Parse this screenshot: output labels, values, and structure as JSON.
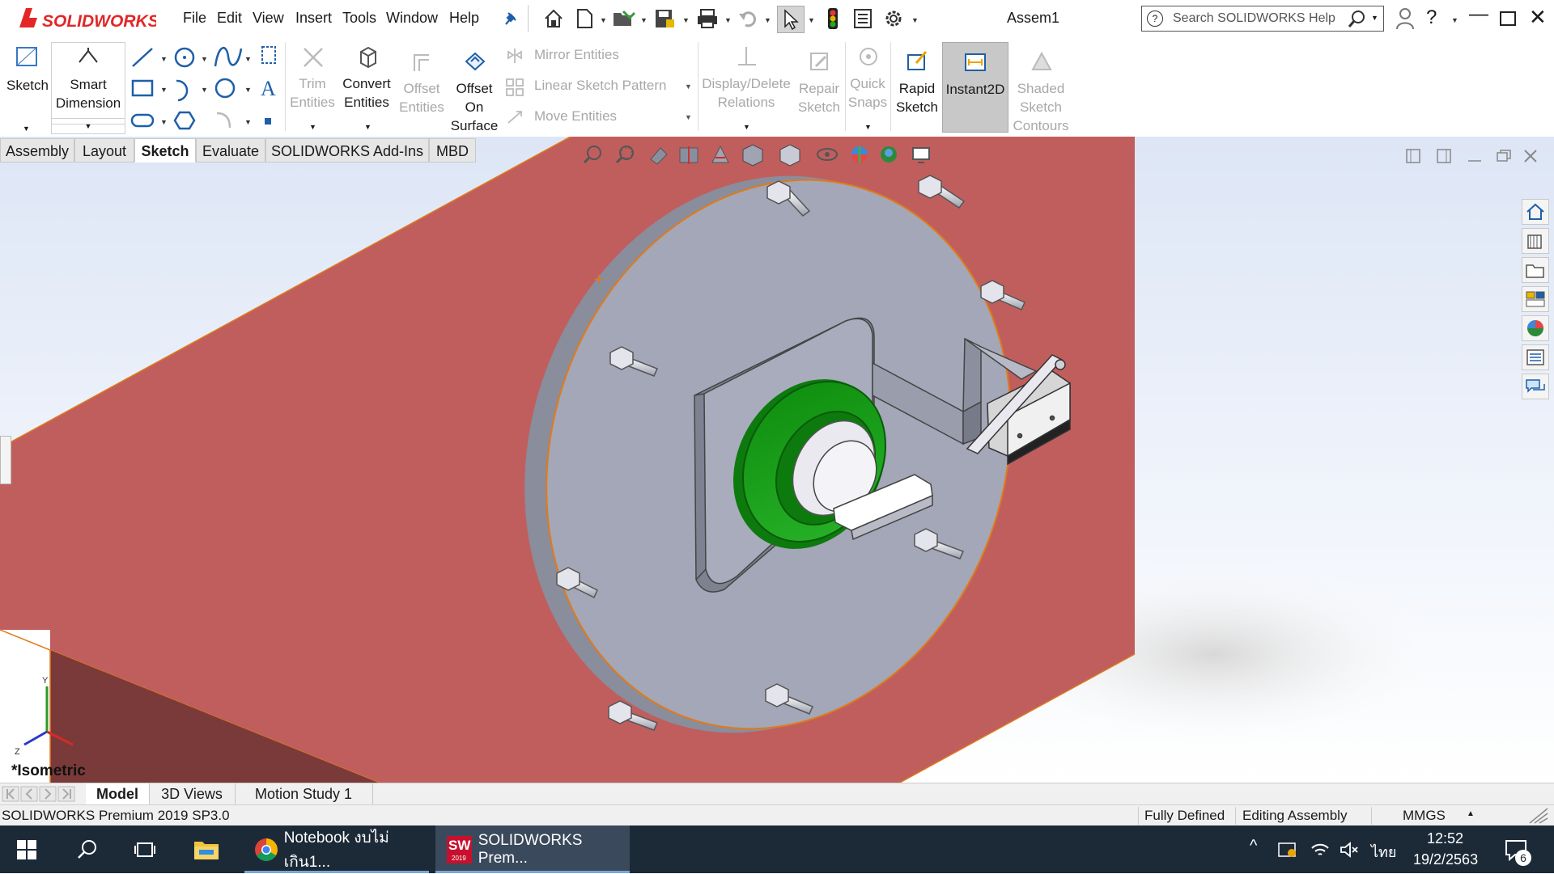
{
  "app": {
    "logo_text": "SOLIDWORKS",
    "document_title": "Assem1",
    "menus": [
      "File",
      "Edit",
      "View",
      "Insert",
      "Tools",
      "Window",
      "Help"
    ],
    "search_placeholder": "Search SOLIDWORKS Help"
  },
  "ribbon": {
    "sketch": "Sketch",
    "smart_dimension_1": "Smart",
    "smart_dimension_2": "Dimension",
    "trim_1": "Trim",
    "trim_2": "Entities",
    "convert_1": "Convert",
    "convert_2": "Entities",
    "offset_1": "Offset",
    "offset_2": "Entities",
    "offset_surface_1": "Offset",
    "offset_surface_2": "On",
    "offset_surface_3": "Surface",
    "mirror": "Mirror Entities",
    "linear_pattern": "Linear Sketch Pattern",
    "move": "Move Entities",
    "display_relations_1": "Display/Delete",
    "display_relations_2": "Relations",
    "repair_1": "Repair",
    "repair_2": "Sketch",
    "quick_snaps_1": "Quick",
    "quick_snaps_2": "Snaps",
    "rapid_1": "Rapid",
    "rapid_2": "Sketch",
    "instant2d": "Instant2D",
    "shaded_1": "Shaded",
    "shaded_2": "Sketch",
    "shaded_3": "Contours"
  },
  "command_tabs": [
    "Assembly",
    "Layout",
    "Sketch",
    "Evaluate",
    "SOLIDWORKS Add-Ins",
    "MBD"
  ],
  "active_command_tab": "Sketch",
  "viewport": {
    "view_label": "*Isometric",
    "triad_y": "Y",
    "triad_z": "Z"
  },
  "bottom_tabs": [
    "Model",
    "3D Views",
    "Motion Study 1"
  ],
  "status": {
    "version": "SOLIDWORKS Premium 2019 SP3.0",
    "defined": "Fully Defined",
    "mode": "Editing Assembly",
    "units": "MMGS"
  },
  "taskbar": {
    "chrome_title": "Notebook งบไม่เกิน1...",
    "sw_title": "SOLIDWORKS Prem...",
    "sw_badge": "SW",
    "sw_year": "2019",
    "language": "ไทย",
    "time": "12:52",
    "date": "19/2/2563",
    "notifications": "6"
  },
  "colors": {
    "ribbon_active": "#c8c8c8",
    "housing": "#c05e5e",
    "plate": "#a3a7b7",
    "seal": "#1f9a1f",
    "taskbar": "#1c2a38"
  }
}
